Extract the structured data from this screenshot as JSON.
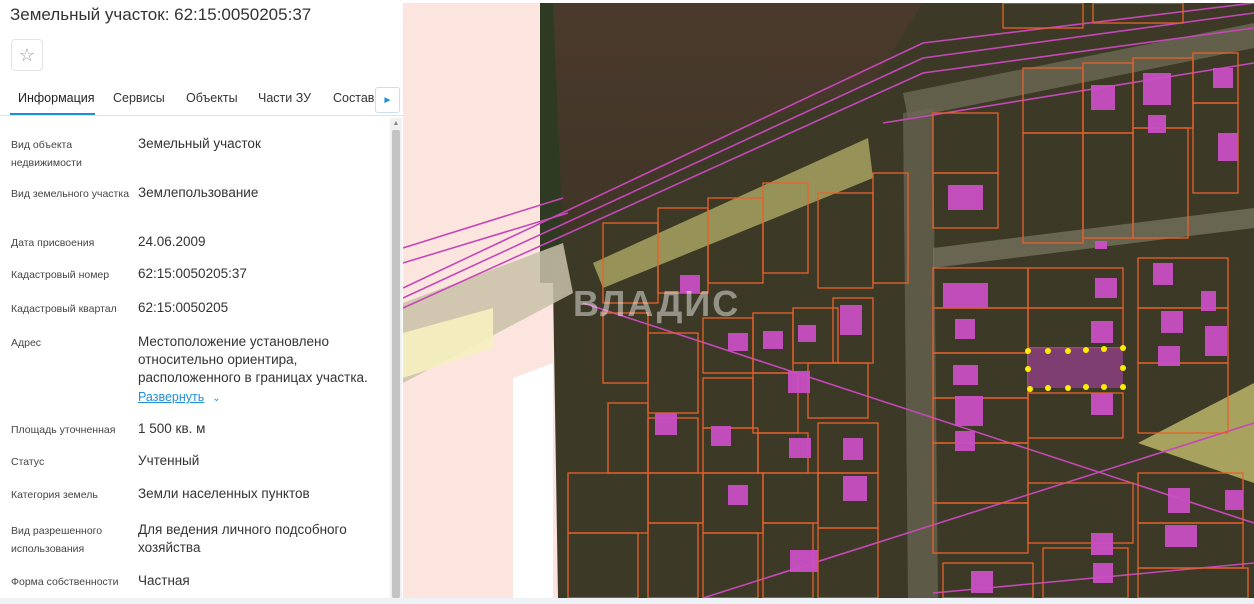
{
  "panel": {
    "title": "Земельный участок: 62:15:0050205:37",
    "star_icon": "☆",
    "tabs": [
      "Информация",
      "Сервисы",
      "Объекты",
      "Части ЗУ",
      "Состав"
    ],
    "next_icon": "►",
    "scroll_up_icon": "▲",
    "fields": [
      {
        "label": "Вид объекта недвижимости",
        "value": "Земельный участок"
      },
      {
        "label": "Вид земельного участка",
        "value": "Землепользование"
      },
      {
        "label": "Дата присвоения",
        "value": "24.06.2009"
      },
      {
        "label": "Кадастровый номер",
        "value": "62:15:0050205:37"
      },
      {
        "label": "Кадастровый квартал",
        "value": "62:15:0050205"
      },
      {
        "label": "Адрес",
        "value": "Местоположение установлено относительно ориентира, расположенного в границах участка."
      },
      {
        "label": "Площадь уточненная",
        "value": "1 500 кв. м"
      },
      {
        "label": "Статус",
        "value": "Учтенный"
      },
      {
        "label": "Категория земель",
        "value": "Земли населенных пунктов"
      },
      {
        "label": "Вид разрешенного использования",
        "value": "Для ведения личного подсобного хозяйства"
      },
      {
        "label": "Форма собственности",
        "value": "Частная"
      }
    ],
    "expand_link": "Развернуть",
    "expand_icon": "⌄"
  },
  "map": {
    "watermark": "ВЛАДИС",
    "colors": {
      "parcel_border": "#e8612c",
      "boundary_line": "#c548b8",
      "building": "#c94fc4",
      "selected_marker": "#ffee00"
    }
  }
}
